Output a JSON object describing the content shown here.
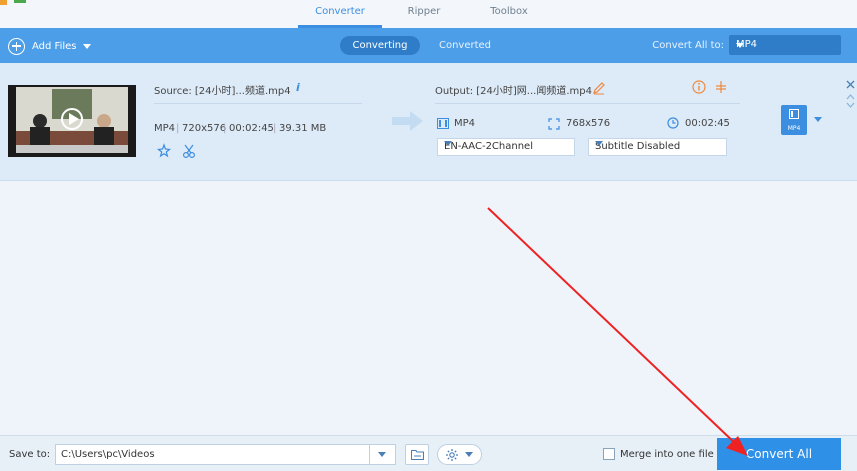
{
  "topnav": {
    "tabs": [
      {
        "label": "Converter",
        "active": true
      },
      {
        "label": "Ripper",
        "active": false
      },
      {
        "label": "Toolbox",
        "active": false
      }
    ]
  },
  "toolbar": {
    "add_files_label": "Add Files",
    "segments": [
      "Converting",
      "Converted"
    ],
    "convert_all_to_label": "Convert All to:",
    "format_value": "MP4"
  },
  "file": {
    "source_label": "Source: [24小时]...频道.mp4",
    "info_glyph": "i",
    "format": "MP4",
    "resolution": "720x576",
    "duration": "00:02:45",
    "size": "39.31 MB",
    "output_label": "Output: [24小时]网...闻频道.mp4",
    "output_format": "MP4",
    "output_resolution": "768x576",
    "output_duration": "00:02:45",
    "audio_track": "EN-AAC-2Channel",
    "subtitle": "Subtitle Disabled",
    "badge_format": "MP4"
  },
  "bottom": {
    "save_to_label": "Save to:",
    "save_path": "C:\\Users\\pc\\Videos",
    "merge_label": "Merge into one file",
    "merge_checked": false,
    "convert_all_label": "Convert All"
  },
  "colors": {
    "accent": "#3c8ee0",
    "toolbar": "#4d9ee8",
    "convert_button": "#2f90e8",
    "annotation_arrow": "#ee2222",
    "warning_icon": "#f0883c"
  }
}
